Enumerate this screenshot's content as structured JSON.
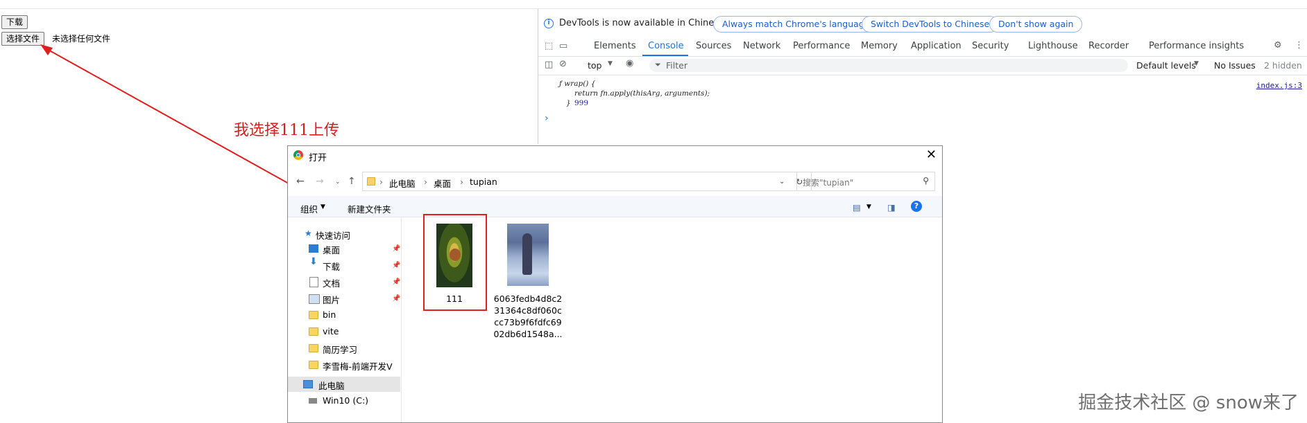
{
  "page": {
    "download_button": "下载",
    "choose_file_button": "选择文件",
    "no_file_text": "未选择任何文件",
    "annotation": "我选择111上传",
    "watermark": "掘金技术社区 @ snow来了"
  },
  "devtools": {
    "infobar": {
      "message": "DevTools is now available in Chinese!",
      "btn_match": "Always match Chrome's language",
      "btn_switch": "Switch DevTools to Chinese",
      "btn_dismiss": "Don't show again"
    },
    "tabs": [
      "Elements",
      "Console",
      "Sources",
      "Network",
      "Performance",
      "Memory",
      "Application",
      "Security",
      "Lighthouse",
      "Recorder",
      "Performance insights"
    ],
    "active_tab": "Console",
    "filterbar": {
      "context": "top",
      "filter_placeholder": "Filter",
      "levels": "Default levels",
      "issues": "No Issues",
      "hidden": "2 hidden"
    },
    "console": {
      "line1": "ƒ wrap() {",
      "line2": "return fn.apply(thisArg, arguments);",
      "line3": "}",
      "line3_value": "999",
      "source_link": "index.js:3",
      "prompt": "›"
    }
  },
  "dialog": {
    "title": "打开",
    "breadcrumbs": [
      "此电脑",
      "桌面",
      "tupian"
    ],
    "search_placeholder": "搜索\"tupian\"",
    "organize": "组织",
    "new_folder": "新建文件夹",
    "nav": {
      "quick_access": "快速访问",
      "items": [
        "桌面",
        "下载",
        "文档",
        "图片",
        "bin",
        "vite",
        "简历学习",
        "李雪梅-前端开发V"
      ],
      "this_pc": "此电脑",
      "drive": "Win10 (C:)"
    },
    "files": [
      {
        "name": "111"
      },
      {
        "name": "6063fedb4d8c2\n31364c8df060c\ncc73b9f6fdfc69\n02db6d1548a..."
      }
    ]
  },
  "colors": {
    "annotation_red": "#e02020",
    "accent_blue": "#1a73e8",
    "folder_yellow": "#f6d36b"
  }
}
